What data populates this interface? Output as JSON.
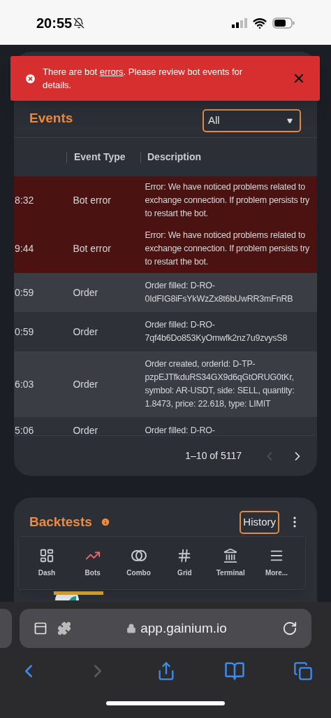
{
  "status_bar": {
    "time": "20:55"
  },
  "toast": {
    "link": "errors",
    "before": "There are bot ",
    "after": ". Please review bot events for details."
  },
  "events": {
    "title": "Events",
    "filter": {
      "value": "All"
    },
    "columns": [
      "Event Type",
      "Description"
    ],
    "rows": [
      {
        "kind": "error",
        "time": "8:32",
        "type": "Bot error",
        "description": "Error: We have noticed problems related to exchange connection. If problem persists try to restart the bot."
      },
      {
        "kind": "error",
        "time": "9:44",
        "type": "Bot error",
        "description": "Error: We have noticed problems related to exchange connection. If problem persists try to restart the bot."
      },
      {
        "kind": "normal",
        "time": "0:59",
        "type": "Order",
        "description": "Order filled: D-RO-0IdFIG8iFsYkWzZx8t6bUwRR3mFnRB"
      },
      {
        "kind": "normal",
        "time": "0:59",
        "type": "Order",
        "description": "Order filled: D-RO-7qf4b6Do853KyOmwfk2nz7u9zvysS8"
      },
      {
        "kind": "normal",
        "time": "6:03",
        "type": "Order",
        "description": "Order created, orderId: D-TP-pzpEJTfkduRS34GX9d6qGtORUG0tKr, symbol: AR-USDT, side: SELL, quantity: 1.8473, price: 22.618, type: LIMIT"
      },
      {
        "kind": "normal",
        "time": "5:06",
        "type": "Order",
        "description": "Order filled: D-RO-"
      }
    ],
    "pagination": {
      "range": "1–10 of 5117",
      "prev_disabled": true
    }
  },
  "backtests": {
    "title": "Backtests",
    "history_button": "History"
  },
  "nav": [
    {
      "label": "Dash",
      "selected": false
    },
    {
      "label": "Bots",
      "selected": true
    },
    {
      "label": "Combo",
      "selected": false
    },
    {
      "label": "Grid",
      "selected": false
    },
    {
      "label": "Terminal",
      "selected": false
    },
    {
      "label": "More...",
      "selected": false
    }
  ],
  "browser": {
    "url": "app.gainium.io",
    "forward_disabled": true
  }
}
